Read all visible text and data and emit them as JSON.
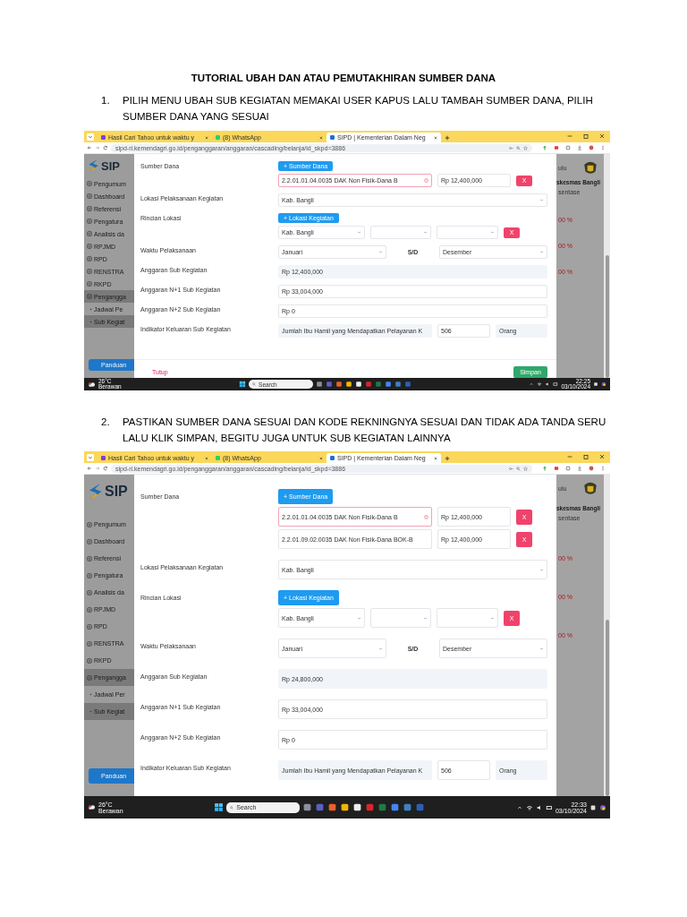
{
  "title": "TUTORIAL UBAH DAN ATAU PEMUTAKHIRAN SUMBER DANA",
  "steps": [
    {
      "number": "1.",
      "text": "PILIH MENU UBAH SUB KEGIATAN MEMAKAI USER KAPUS LALU TAMBAH SUMBER DANA, PILIH SUMBER DANA YANG SESUAI",
      "screen": {
        "tabs": [
          {
            "label": "Hasil Cari Tahoo untuk waktu y",
            "selected": false
          },
          {
            "label": "(8) WhatsApp",
            "selected": false
          },
          {
            "label": "SIPD | Kementerian Dalam Neg",
            "selected": true
          }
        ],
        "url": "sipd-ri.kemendagri.go.id/penganggaran/anggaran/cascading/belanja/id_skpd=3886",
        "logo": "SIP",
        "sidebar": [
          {
            "label": "Pengumum",
            "kind": "main",
            "selected": false
          },
          {
            "label": "Dashboard",
            "kind": "main",
            "selected": false
          },
          {
            "label": "Referensi",
            "kind": "main",
            "selected": false
          },
          {
            "label": "Pengatura",
            "kind": "main",
            "selected": false
          },
          {
            "label": "Analisis da",
            "kind": "main",
            "selected": false
          },
          {
            "label": "RPJMD",
            "kind": "main",
            "selected": false
          },
          {
            "label": "RPD",
            "kind": "main",
            "selected": false
          },
          {
            "label": "RENSTRA",
            "kind": "main",
            "selected": false
          },
          {
            "label": "RKPD",
            "kind": "main",
            "selected": false
          },
          {
            "label": "Pengangga",
            "kind": "main",
            "selected": true
          },
          {
            "label": "Jadwal Pe",
            "kind": "sub",
            "selected": false
          },
          {
            "label": "Sub Kegiat",
            "kind": "sub",
            "selected": true
          }
        ],
        "help_button": "Panduan",
        "right_panel": {
          "caption": "ulu",
          "heading": "skesmas Bangli",
          "label": "sentase",
          "values": [
            "00 %",
            "00 %",
            "00 %"
          ]
        },
        "form": [
          {
            "kind": "sources",
            "label": "Sumber Dana",
            "button": "+ Sumber Dana",
            "entries": [
              {
                "code": "2.2.01.01.04.0035 DAK Non Fisik-Dana B",
                "amount": "Rp 12,400,000",
                "warning": true,
                "remove": "X"
              }
            ]
          },
          {
            "kind": "select",
            "label": "Lokasi Pelaksanaan Kegiatan",
            "value": "Kab. Bangli"
          },
          {
            "kind": "locations",
            "label": "Rincian Lokasi",
            "button": "+ Lokasi Kegiatan",
            "value": "Kab. Bangli",
            "remove": "X"
          },
          {
            "kind": "range",
            "label": "Waktu Pelaksanaan",
            "from": "Januari",
            "separator": "S/D",
            "to": "Desember"
          },
          {
            "kind": "readonly",
            "label": "Anggaran Sub Kegiatan",
            "value": "Rp 12,400,000"
          },
          {
            "kind": "input",
            "label": "Anggaran N+1 Sub Kegiatan",
            "value": "Rp 33,004,000"
          },
          {
            "kind": "input",
            "label": "Anggaran N+2 Sub Kegiatan",
            "value": "Rp 0"
          },
          {
            "kind": "indicator",
            "label": "Indikator Keluaran Sub Kegiatan",
            "value": "Jumlah Ibu Hamil yang Mendapatkan Pelayanan K",
            "target": "506",
            "unit": "Orang"
          }
        ],
        "footer": {
          "cancel": "Tutup",
          "save": "Simpan"
        },
        "taskbar": {
          "temperature": "26°C",
          "weather": "Berawan",
          "search": "Search",
          "time": "22:25",
          "date": "03/10/2024"
        }
      }
    },
    {
      "number": "2.",
      "text": "PASTIKAN SUMBER DANA SESUAI DAN KODE REKNINGNYA SESUAI DAN TIDAK ADA TANDA SERU LALU KLIK SIMPAN, BEGITU JUGA UNTUK SUB KEGIATAN LAINNYA",
      "screen": {
        "tabs": [
          {
            "label": "Hasil Cari Tahoo untuk waktu y",
            "selected": false
          },
          {
            "label": "(8) WhatsApp",
            "selected": false
          },
          {
            "label": "SIPD | Kementerian Dalam Neg",
            "selected": true
          }
        ],
        "url": "sipd-ri.kemendagri.go.id/penganggaran/anggaran/cascading/belanja/id_skpd=3886",
        "logo": "SIP",
        "sidebar": [
          {
            "label": "Pengumum",
            "kind": "main",
            "selected": false
          },
          {
            "label": "Dashboard",
            "kind": "main",
            "selected": false
          },
          {
            "label": "Referensi",
            "kind": "main",
            "selected": false
          },
          {
            "label": "Pengatura",
            "kind": "main",
            "selected": false
          },
          {
            "label": "Analisis da",
            "kind": "main",
            "selected": false
          },
          {
            "label": "RPJMD",
            "kind": "main",
            "selected": false
          },
          {
            "label": "RPD",
            "kind": "main",
            "selected": false
          },
          {
            "label": "RENSTRA",
            "kind": "main",
            "selected": false
          },
          {
            "label": "RKPD",
            "kind": "main",
            "selected": false
          },
          {
            "label": "Pengangga",
            "kind": "main",
            "selected": true
          },
          {
            "label": "Jadwal Per",
            "kind": "sub",
            "selected": false
          },
          {
            "label": "Sub Kegiat",
            "kind": "sub",
            "selected": true
          }
        ],
        "help_button": "Panduan",
        "right_panel": {
          "caption": "ulu",
          "heading": "skesmas Bangli",
          "label": "sentase",
          "values": [
            "00 %",
            "00 %",
            "00 %"
          ]
        },
        "form": [
          {
            "kind": "sources",
            "label": "Sumber Dana",
            "button": "+ Sumber Dana",
            "entries": [
              {
                "code": "2.2.01.01.04.0035 DAK Non Fisik-Dana B",
                "amount": "Rp 12,400,000",
                "warning": true,
                "remove": "X"
              },
              {
                "code": "2.2.01.09.02.0035 DAK Non Fisik-Dana BOK-B",
                "amount": "Rp 12,400,000",
                "warning": false,
                "remove": "X"
              }
            ]
          },
          {
            "kind": "select",
            "label": "Lokasi Pelaksanaan Kegiatan",
            "value": "Kab. Bangli"
          },
          {
            "kind": "locations",
            "label": "Rincian Lokasi",
            "button": "+ Lokasi Kegiatan",
            "value": "Kab. Bangli",
            "remove": "X"
          },
          {
            "kind": "range",
            "label": "Waktu Pelaksanaan",
            "from": "Januari",
            "separator": "S/D",
            "to": "Desember"
          },
          {
            "kind": "readonly",
            "label": "Anggaran Sub Kegiatan",
            "value": "Rp 24,800,000"
          },
          {
            "kind": "input",
            "label": "Anggaran N+1 Sub Kegiatan",
            "value": "Rp 33,004,000"
          },
          {
            "kind": "input",
            "label": "Anggaran N+2 Sub Kegiatan",
            "value": "Rp 0"
          },
          {
            "kind": "indicator",
            "label": "Indikator Keluaran Sub Kegiatan",
            "value": "Jumlah Ibu Hamil yang Mendapatkan Pelayanan K",
            "target": "506",
            "unit": "Orang"
          }
        ],
        "taskbar": {
          "temperature": "26°C",
          "weather": "Berawan",
          "search": "Search",
          "time": "22:33",
          "date": "03/10/2024"
        }
      }
    }
  ]
}
